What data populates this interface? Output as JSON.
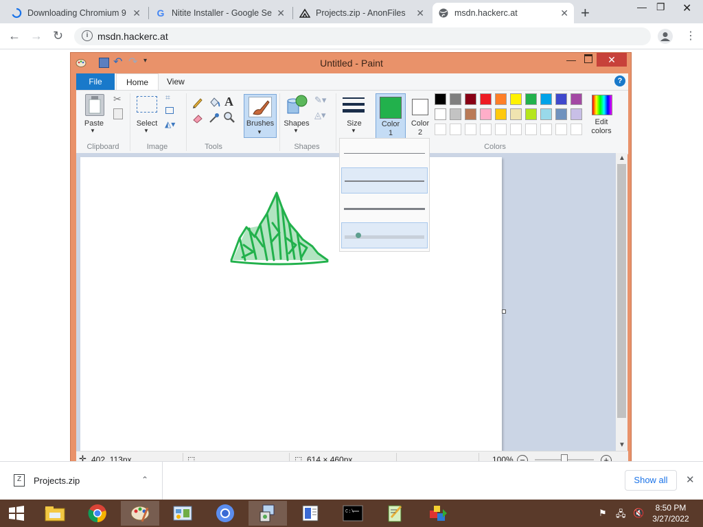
{
  "browser": {
    "tabs": [
      {
        "title": "Downloading Chromium 9",
        "icon": "loading-spinner-icon"
      },
      {
        "title": "Nitite Installer - Google Se",
        "icon": "google-g-icon"
      },
      {
        "title": "Projects.zip - AnonFiles",
        "icon": "anonfiles-icon"
      },
      {
        "title": "msdn.hackerc.at",
        "icon": "globe-icon"
      }
    ],
    "url": "msdn.hackerc.at"
  },
  "paint": {
    "title": "Untitled - Paint",
    "ribbon_tabs": [
      "File",
      "Home",
      "View"
    ],
    "tools": {
      "paste": "Paste",
      "select": "Select",
      "brushes": "Brushes",
      "shapes": "Shapes",
      "size": "Size",
      "color1_a": "Color",
      "color1_b": "1",
      "color2_a": "Color",
      "color2_b": "2",
      "edit_colors_a": "Edit",
      "edit_colors_b": "colors"
    },
    "groups": {
      "clipboard": "Clipboard",
      "image": "Image",
      "tools": "Tools",
      "shapes": "Shapes",
      "colors": "Colors"
    },
    "color1": "#22b14c",
    "color2": "#ffffff",
    "palette_row1": [
      "#000000",
      "#7f7f7f",
      "#880015",
      "#ed1c24",
      "#ff7f27",
      "#fff200",
      "#22b14c",
      "#00a2e8",
      "#3f48cc",
      "#a349a4"
    ],
    "palette_row2": [
      "#ffffff",
      "#c3c3c3",
      "#b97a57",
      "#ffaec9",
      "#ffc90e",
      "#efe4b0",
      "#b5e61d",
      "#99d9ea",
      "#7092be",
      "#c8bfe7"
    ],
    "status": {
      "cursor_pos": "402, 113px",
      "canvas_size": "614 × 460px",
      "zoom": "100%"
    }
  },
  "downloads": {
    "file": "Projects.zip",
    "show_all": "Show all"
  },
  "clock": {
    "time": "8:50 PM",
    "date": "3/27/2022"
  }
}
